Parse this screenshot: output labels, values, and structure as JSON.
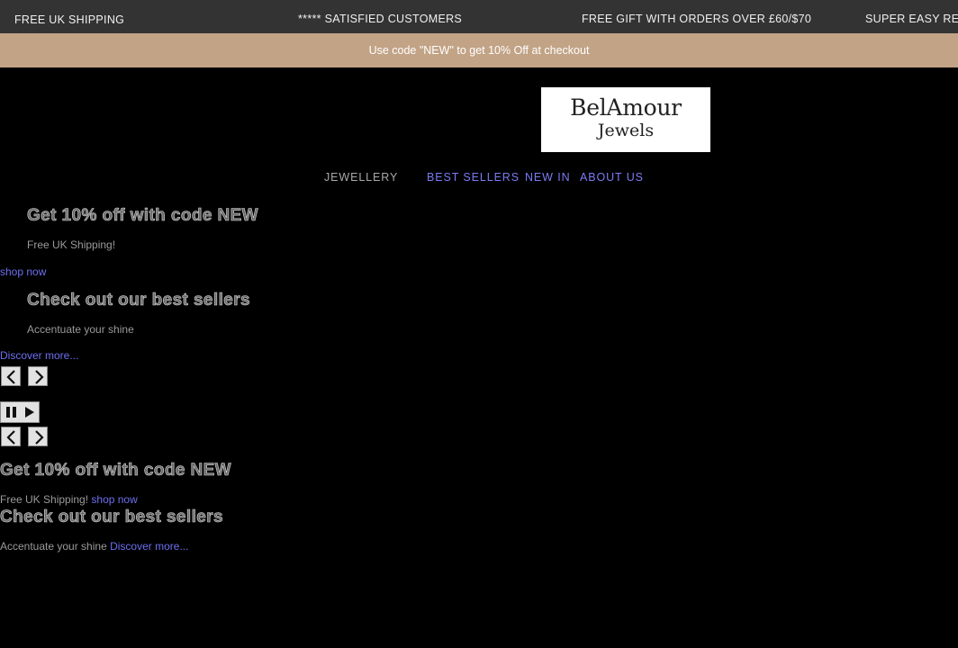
{
  "announcement_bar": {
    "items": [
      "FREE UK SHIPPING",
      "***** SATISFIED CUSTOMERS",
      "FREE GIFT WITH ORDERS OVER £60/$70",
      "SUPER EASY RE"
    ]
  },
  "promo_bar": {
    "text": "Use code \"NEW\" to get 10% Off at checkout"
  },
  "logo": {
    "line1": "BelAmour",
    "line2": "Jewels"
  },
  "nav": {
    "jewellery": "JEWELLERY",
    "best_sellers": "BEST SELLERS",
    "new_in": "NEW IN",
    "about_us": "ABOUT US"
  },
  "slides": [
    {
      "heading": "Get 10% off with code NEW",
      "subtext": "Free UK Shipping!",
      "link": "shop now"
    },
    {
      "heading": "Check out our best sellers",
      "subtext": "Accentuate your shine",
      "link": "Discover more..."
    }
  ],
  "icons": {
    "prev": "chevron-left-icon",
    "next": "chevron-right-icon",
    "pause": "pause-icon",
    "play": "play-icon"
  }
}
